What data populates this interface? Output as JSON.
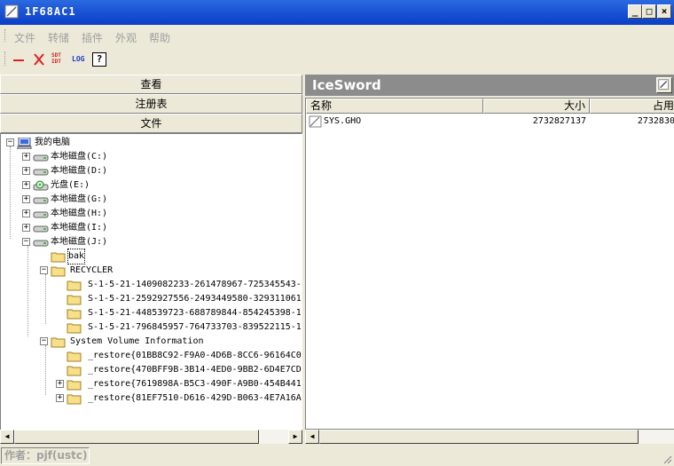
{
  "window": {
    "title": "1F68AC1",
    "minimize": "_",
    "maximize": "□",
    "close": "×"
  },
  "menu": {
    "items": [
      "文件",
      "转储",
      "插件",
      "外观",
      "帮助"
    ]
  },
  "toolbar": {
    "tools": [
      {
        "name": "minus-icon",
        "label": "—"
      },
      {
        "name": "delete-x-icon",
        "label": "✕"
      },
      {
        "name": "sdt-idt-icon",
        "label": "SDT IDT"
      },
      {
        "name": "log-icon",
        "label": "LOG"
      },
      {
        "name": "help-icon",
        "label": "?"
      }
    ],
    "sdt_top": "SDT",
    "sdt_bottom": "IDT",
    "log": "LOG",
    "help": "?"
  },
  "left_panel": {
    "view_button": "查看",
    "registry_button": "注册表",
    "files_button": "文件"
  },
  "tree": {
    "root": "我的电脑",
    "drives": [
      "本地磁盘(C:)",
      "本地磁盘(D:)",
      "光盘(E:)",
      "本地磁盘(G:)",
      "本地磁盘(H:)",
      "本地磁盘(I:)",
      "本地磁盘(J:)"
    ],
    "j_children": {
      "bak": "bak",
      "recycler": "RECYCLER",
      "recycler_items": [
        "S-1-5-21-1409082233-261478967-725345543-",
        "S-1-5-21-2592927556-2493449580-329311061",
        "S-1-5-21-448539723-688789844-854245398-1",
        "S-1-5-21-796845957-764733703-839522115-1"
      ],
      "svi": "System Volume Information",
      "svi_items": [
        "_restore{01BB8C92-F9A0-4D6B-8CC6-96164C0",
        "_restore{470BFF9B-3B14-4ED0-9BB2-6D4E7CD",
        "_restore{7619898A-B5C3-490F-A9B0-454B441",
        "_restore{81EF7510-D616-429D-B063-4E7A16A"
      ]
    }
  },
  "right_panel": {
    "title": "IceSword",
    "columns": {
      "name": "名称",
      "size": "大小",
      "used": "占用"
    },
    "rows": [
      {
        "name": "SYS.GHO",
        "size": "2732827137",
        "used": "2732830"
      }
    ]
  },
  "status": {
    "author": "作者：pjf(ustc)"
  },
  "colors": {
    "title_blue": "#0a3fc8",
    "panel_gray": "#8c8c8c",
    "chrome": "#ece9d8"
  }
}
